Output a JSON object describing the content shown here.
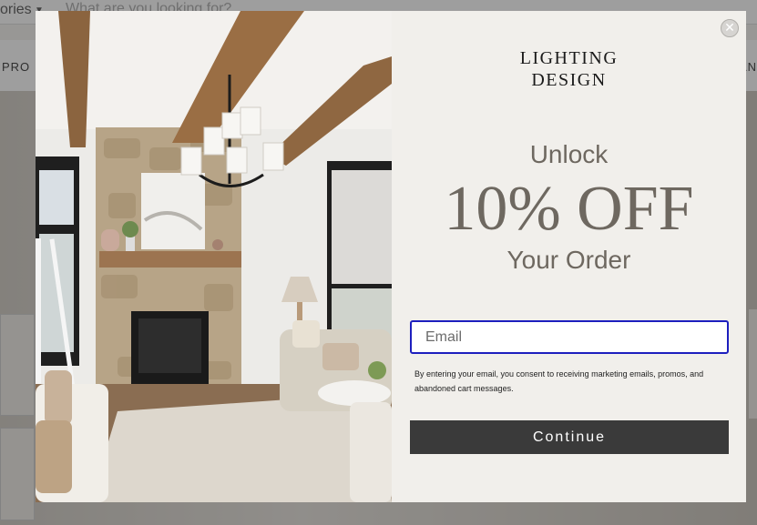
{
  "background_page": {
    "category_label": "ories",
    "search_placeholder": "What are you looking for?",
    "nav_left_label": "PRO",
    "nav_right_label": "AN"
  },
  "popup": {
    "brand_line1": "LIGHTING",
    "brand_line2": "DESIGN",
    "close_icon": "close-icon",
    "headline_unlock": "Unlock",
    "headline_offer": "10% OFF",
    "headline_order": "Your Order",
    "email_placeholder": "Email",
    "email_value": "",
    "consent_text": "By entering your email, you consent to receiving marketing emails, promos, and abandoned cart messages.",
    "continue_label": "Continue"
  },
  "colors": {
    "accent_text": "#6e6860",
    "button_bg": "#3a3a3a",
    "input_focus_border": "#1d1fbe",
    "panel_bg": "#f1efeb"
  }
}
